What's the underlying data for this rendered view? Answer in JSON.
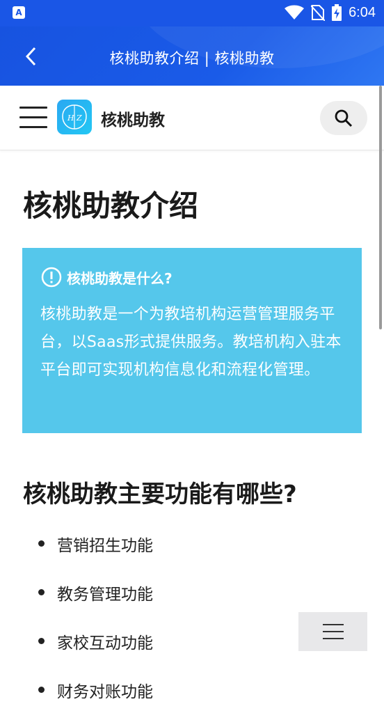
{
  "status_bar": {
    "app_badge": "A",
    "time": "6:04",
    "icons": [
      "wifi-icon",
      "no-sim-icon",
      "battery-charging-icon"
    ]
  },
  "app_bar": {
    "title": "核桃助教介绍 | 核桃助教",
    "back_icon": "chevron-left-icon"
  },
  "site_header": {
    "site_name": "核桃助教",
    "menu_icon": "hamburger-icon",
    "search_icon": "search-icon"
  },
  "content": {
    "page_title": "核桃助教介绍",
    "info_box": {
      "heading": "核桃助教是什么?",
      "icon": "exclamation-circle-icon",
      "text": "核桃助教是一个为教培机构运营管理服务平台，以Saas形式提供服务。教培机构入驻本平台即可实现机构信息化和流程化管理。",
      "background": "#55c7eb"
    },
    "section_title": "核桃助教主要功能有哪些?",
    "features": [
      "营销招生功能",
      "教务管理功能",
      "家校互动功能",
      "财务对账功能"
    ]
  },
  "colors": {
    "accent": "#1a56e6",
    "info": "#55c7eb"
  }
}
